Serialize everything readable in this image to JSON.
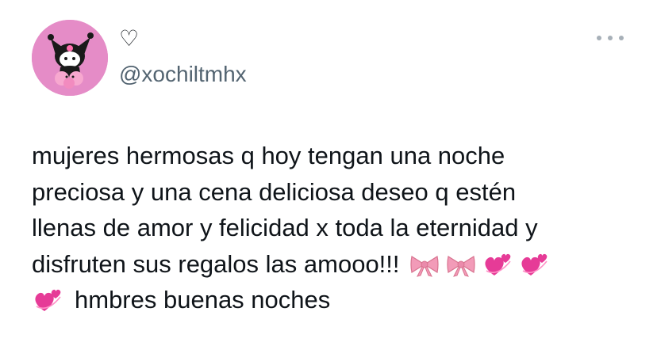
{
  "tweet": {
    "display_name": "♡",
    "handle": "@xochiltmhx",
    "more_icon": "more-horizontal-icon",
    "text_lines": {
      "l1": "mujeres hermosas q hoy tengan una noche",
      "l2": "preciosa y una cena deliciosa deseo q estén",
      "l3": "llenas de amor y felicidad x toda la eternidad y",
      "l4": "disfruten sus regalos las amooo!!!",
      "l5": "hmbres buenas noches"
    },
    "emojis": [
      "ribbon-icon",
      "ribbon-icon",
      "revolving-hearts-icon",
      "revolving-hearts-icon",
      "revolving-hearts-icon"
    ]
  },
  "colors": {
    "avatar_bg": "#e58cc7",
    "text": "#0f1419",
    "handle": "#536471",
    "more_dots": "#a7b0b8",
    "ribbon": "#f29bb8",
    "hearts": "#e63b97"
  }
}
